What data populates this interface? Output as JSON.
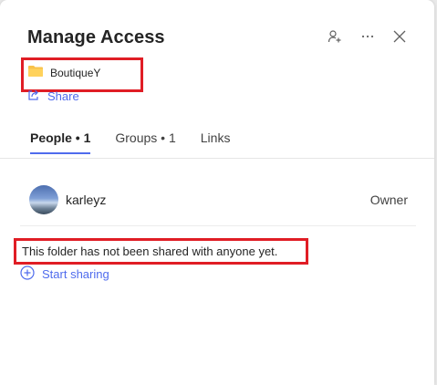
{
  "dialog": {
    "title": "Manage Access",
    "folder_name": "BoutiqueY",
    "share_label": "Share"
  },
  "header_icons": [
    "add-person-icon",
    "more-options-icon",
    "close-icon"
  ],
  "tabs": [
    {
      "label": "People • 1",
      "active": true
    },
    {
      "label": "Groups • 1",
      "active": false
    },
    {
      "label": "Links",
      "active": false
    }
  ],
  "people": [
    {
      "name": "karleyz",
      "role": "Owner"
    }
  ],
  "empty_state": {
    "message": "This folder has not been shared with anyone yet.",
    "start_sharing_label": "Start sharing"
  },
  "colors": {
    "accent": "#4f6bed",
    "highlight": "#e01d25",
    "folder": "#f8c24a"
  }
}
